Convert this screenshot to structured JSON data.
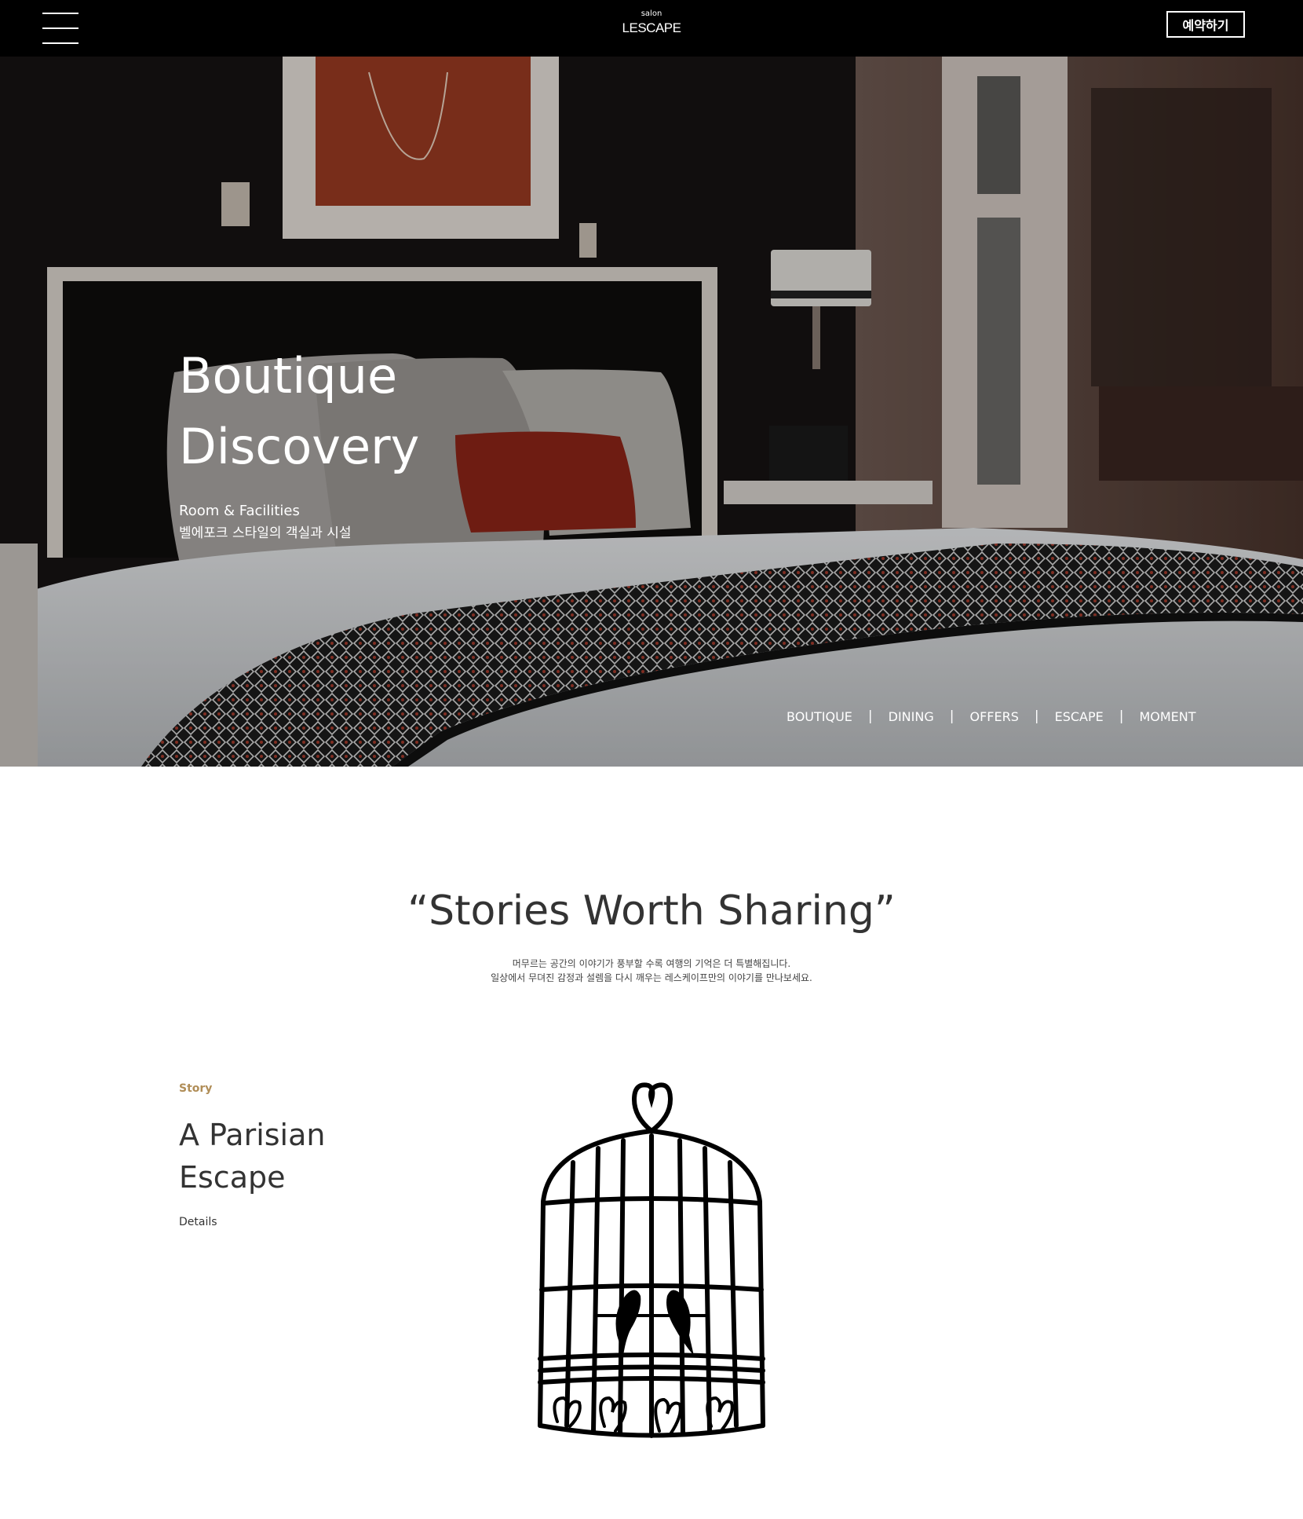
{
  "header": {
    "logo_small": "salon",
    "logo_main": "LESCAPE",
    "reserve_label": "예약하기"
  },
  "hero": {
    "title_line1": "Boutique",
    "title_line2": "Discovery",
    "subtitle": "Room & Facilities",
    "subtitle_ko": "벨에포크 스타일의 객실과 시설",
    "nav": [
      "BOUTIQUE",
      "DINING",
      "OFFERS",
      "ESCAPE",
      "MOMENT"
    ],
    "nav_separator": "|"
  },
  "stories": {
    "title": "“Stories Worth Sharing”",
    "desc_line1": "머무르는 공간의 이야기가 풍부할 수록 여행의 기억은 더 특별해집니다.",
    "desc_line2": "일상에서 무뎌진 감정과 설렘을 다시 깨우는 레스케이프만의 이야기를 만나보세요."
  },
  "story": {
    "label": "Story",
    "title_line1": "A Parisian",
    "title_line2": "Escape",
    "details": "Details"
  },
  "colors": {
    "accent_gold": "#b08d57",
    "header_bg": "#000000"
  },
  "icons": {
    "menu": "hamburger-icon",
    "illustration": "birdcage-illustration"
  }
}
